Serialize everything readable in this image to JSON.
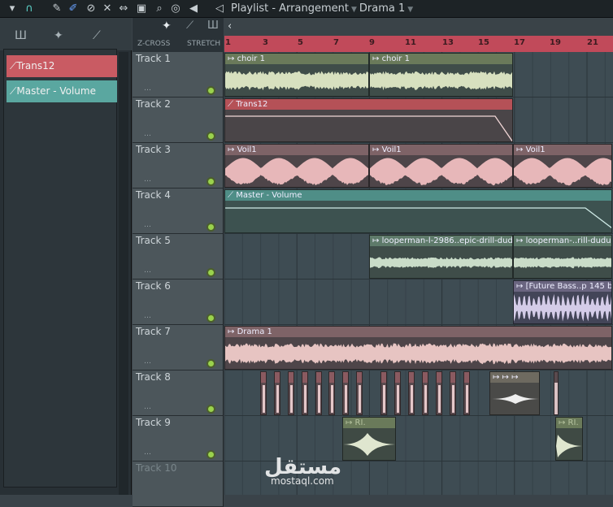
{
  "window": {
    "title": "Playlist - Arrangement",
    "pattern": "Drama 1"
  },
  "toolbar_icons": [
    "menu-arrow-icon",
    "magnet-icon",
    "draw-icon",
    "paint-icon",
    "delete-icon",
    "mute-icon",
    "slip-icon",
    "select-icon",
    "zoom-icon",
    "playback-icon",
    "speaker-icon"
  ],
  "left_panel": {
    "tools": [
      "piano-roll-icon",
      "audio-clip-icon",
      "automation-icon"
    ],
    "items": [
      {
        "label": "Trans12",
        "color": "#c95b63"
      },
      {
        "label": "Master - Volume",
        "color": "#5aa7a0"
      }
    ]
  },
  "header_tools": {
    "zcross": "Z-CROSS",
    "stretch": "STRETCH"
  },
  "timeline": {
    "ticks": [
      "1",
      "3",
      "5",
      "7",
      "9",
      "11",
      "13",
      "15",
      "17",
      "19",
      "21"
    ]
  },
  "tracks": [
    "Track 1",
    "Track 2",
    "Track 3",
    "Track 4",
    "Track 5",
    "Track 6",
    "Track 7",
    "Track 8",
    "Track 9",
    "Track 10"
  ],
  "clips": {
    "choir1": "choir 1",
    "choir2": "choir 1",
    "trans": "Trans12",
    "voil1": "Voil1",
    "voil2": "Voil1",
    "voil3": "Voil1",
    "master": "Master - Volume",
    "loop1": "looperman-l-2986..epic-drill-duduk",
    "loop2": "looperman-..rill-duduk",
    "future": "[Future Bass..p 145 bpm",
    "drama": "Drama 1"
  },
  "colors": {
    "accent": "#c14a5a",
    "led": "#9ad24d"
  },
  "watermark": {
    "arabic": "مستقل",
    "latin": "mostaql.com"
  }
}
